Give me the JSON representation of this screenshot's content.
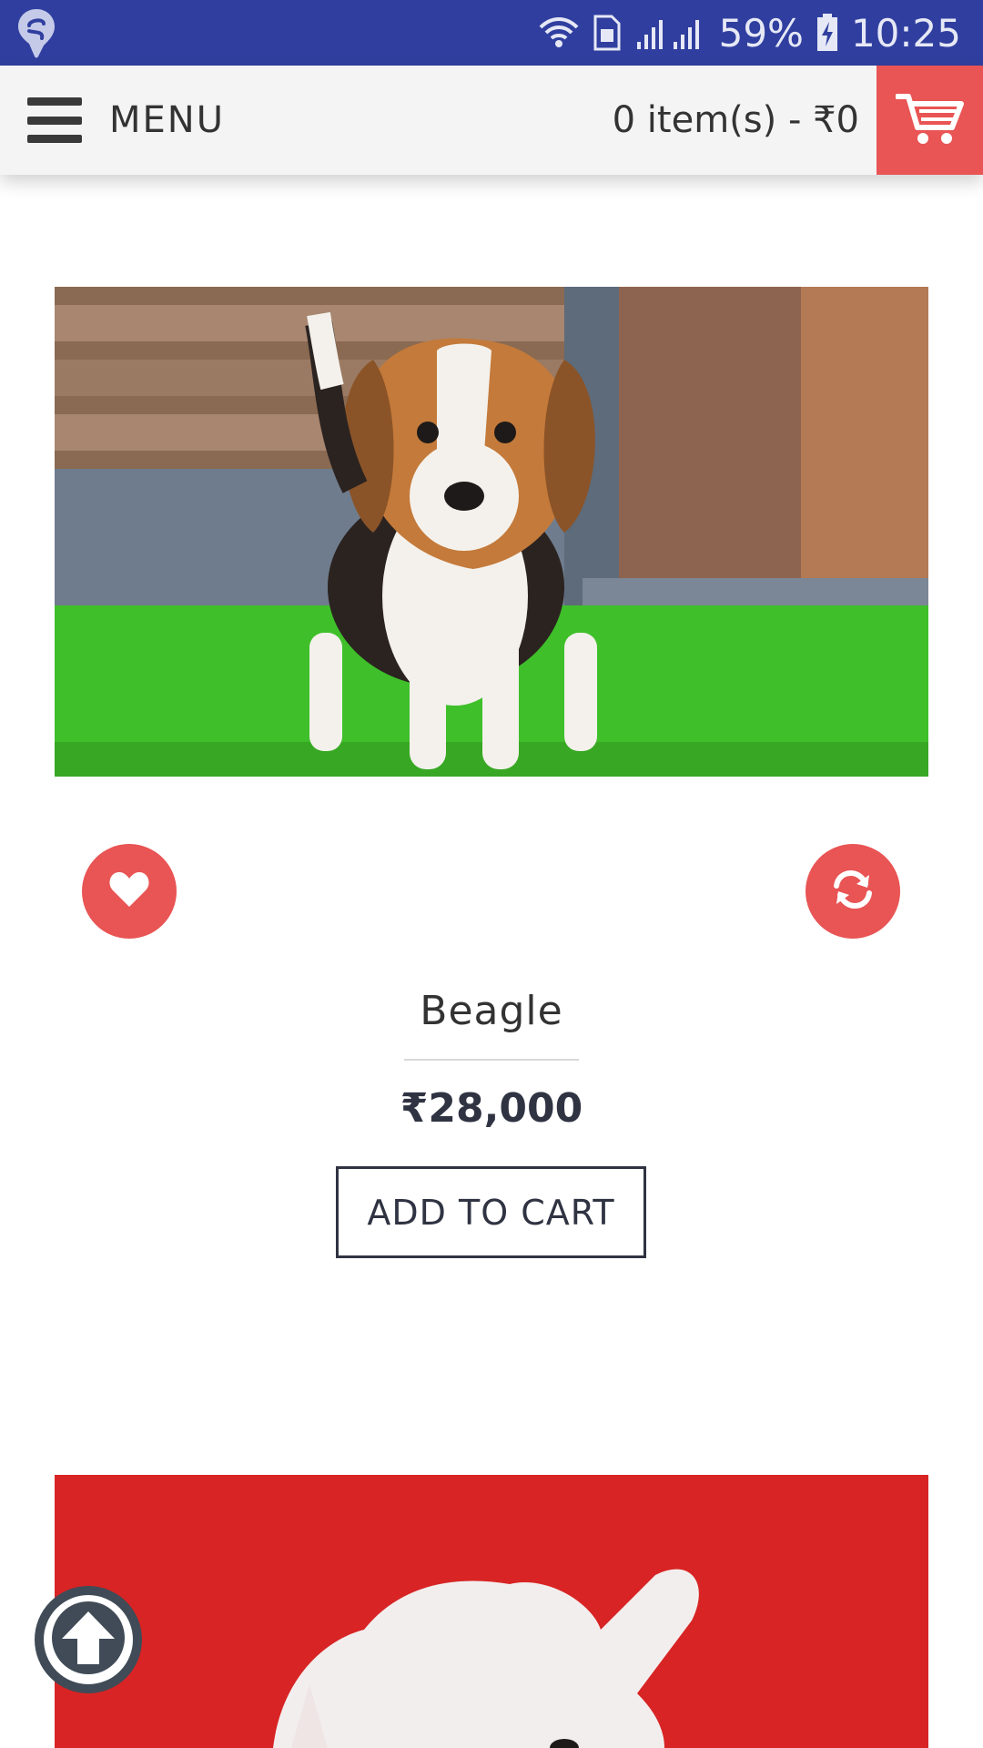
{
  "status_bar": {
    "battery": "59%",
    "time": "10:25"
  },
  "header": {
    "menu_label": "MENU",
    "cart_summary": "0 item(s) - ₹0"
  },
  "products": [
    {
      "name": "Beagle",
      "price": "₹28,000",
      "add_to_cart_label": "ADD TO CART"
    }
  ],
  "icons": {
    "app_logo": "swiggy-logo-icon",
    "wifi": "wifi-icon",
    "sim": "sim-icon",
    "signal": "signal-icon",
    "battery": "battery-charging-icon",
    "hamburger": "hamburger-menu-icon",
    "cart": "cart-icon",
    "wishlist": "heart-icon",
    "compare": "refresh-icon",
    "scroll_top": "arrow-up-icon"
  },
  "colors": {
    "status_bar": "#303f9f",
    "accent": "#e95454",
    "header_bg": "#f4f4f4",
    "text_dark": "#2f3342"
  }
}
